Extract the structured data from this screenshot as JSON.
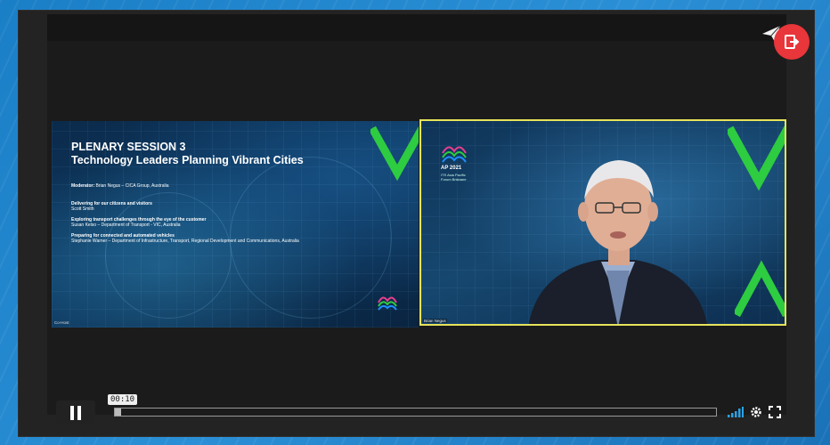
{
  "slide": {
    "title": "PLENARY SESSION 3",
    "subtitle": "Technology Leaders Planning Vibrant Cities",
    "moderator_label": "Moderator:",
    "moderator_text": "Brian Negus – CICA Group, Australia",
    "topic1": "Delivering for our citizens and visitors",
    "topic1_speaker": "Scott Smith",
    "topic2": "Exploring transport challenges through the eye of the customer",
    "topic2_speaker": "Susan Kelso – Department of Transport - VIC, Australia",
    "topic3": "Preparing for connected and automated vehicles",
    "topic3_speaker": "Stephanie Warner – Department of Infrastructure, Transport, Regional Development and Communications, Australia",
    "participant_label": "Co-Host"
  },
  "camera": {
    "logo_title": "AP 2021",
    "logo_sub": "ITS Asia Pacific Forum Brisbane",
    "participant_label": "Brian Negus"
  },
  "player": {
    "current_time": "00:10",
    "progress_fraction": 0.01
  },
  "colors": {
    "exit_button": "#e8363a",
    "active_speaker_border": "#e6e35a",
    "volume_icon": "#2aa3e6"
  },
  "icons": {
    "share": "paper-plane-icon",
    "exit": "exit-icon",
    "play_pause": "pause-icon",
    "volume": "volume-bars-icon",
    "settings": "gear-icon",
    "fullscreen": "fullscreen-icon"
  }
}
